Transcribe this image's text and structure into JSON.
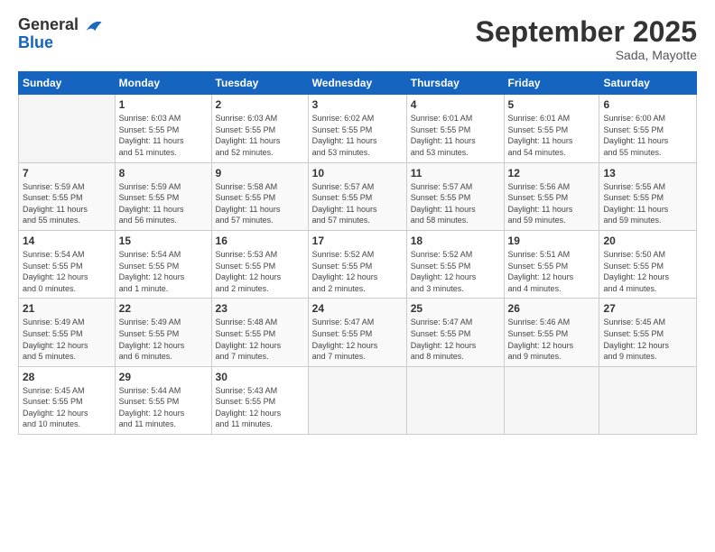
{
  "header": {
    "logo_general": "General",
    "logo_blue": "Blue",
    "month_title": "September 2025",
    "location": "Sada, Mayotte"
  },
  "columns": [
    "Sunday",
    "Monday",
    "Tuesday",
    "Wednesday",
    "Thursday",
    "Friday",
    "Saturday"
  ],
  "weeks": [
    [
      {
        "day": "",
        "info": ""
      },
      {
        "day": "1",
        "info": "Sunrise: 6:03 AM\nSunset: 5:55 PM\nDaylight: 11 hours\nand 51 minutes."
      },
      {
        "day": "2",
        "info": "Sunrise: 6:03 AM\nSunset: 5:55 PM\nDaylight: 11 hours\nand 52 minutes."
      },
      {
        "day": "3",
        "info": "Sunrise: 6:02 AM\nSunset: 5:55 PM\nDaylight: 11 hours\nand 53 minutes."
      },
      {
        "day": "4",
        "info": "Sunrise: 6:01 AM\nSunset: 5:55 PM\nDaylight: 11 hours\nand 53 minutes."
      },
      {
        "day": "5",
        "info": "Sunrise: 6:01 AM\nSunset: 5:55 PM\nDaylight: 11 hours\nand 54 minutes."
      },
      {
        "day": "6",
        "info": "Sunrise: 6:00 AM\nSunset: 5:55 PM\nDaylight: 11 hours\nand 55 minutes."
      }
    ],
    [
      {
        "day": "7",
        "info": "Sunrise: 5:59 AM\nSunset: 5:55 PM\nDaylight: 11 hours\nand 55 minutes."
      },
      {
        "day": "8",
        "info": "Sunrise: 5:59 AM\nSunset: 5:55 PM\nDaylight: 11 hours\nand 56 minutes."
      },
      {
        "day": "9",
        "info": "Sunrise: 5:58 AM\nSunset: 5:55 PM\nDaylight: 11 hours\nand 57 minutes."
      },
      {
        "day": "10",
        "info": "Sunrise: 5:57 AM\nSunset: 5:55 PM\nDaylight: 11 hours\nand 57 minutes."
      },
      {
        "day": "11",
        "info": "Sunrise: 5:57 AM\nSunset: 5:55 PM\nDaylight: 11 hours\nand 58 minutes."
      },
      {
        "day": "12",
        "info": "Sunrise: 5:56 AM\nSunset: 5:55 PM\nDaylight: 11 hours\nand 59 minutes."
      },
      {
        "day": "13",
        "info": "Sunrise: 5:55 AM\nSunset: 5:55 PM\nDaylight: 11 hours\nand 59 minutes."
      }
    ],
    [
      {
        "day": "14",
        "info": "Sunrise: 5:54 AM\nSunset: 5:55 PM\nDaylight: 12 hours\nand 0 minutes."
      },
      {
        "day": "15",
        "info": "Sunrise: 5:54 AM\nSunset: 5:55 PM\nDaylight: 12 hours\nand 1 minute."
      },
      {
        "day": "16",
        "info": "Sunrise: 5:53 AM\nSunset: 5:55 PM\nDaylight: 12 hours\nand 2 minutes."
      },
      {
        "day": "17",
        "info": "Sunrise: 5:52 AM\nSunset: 5:55 PM\nDaylight: 12 hours\nand 2 minutes."
      },
      {
        "day": "18",
        "info": "Sunrise: 5:52 AM\nSunset: 5:55 PM\nDaylight: 12 hours\nand 3 minutes."
      },
      {
        "day": "19",
        "info": "Sunrise: 5:51 AM\nSunset: 5:55 PM\nDaylight: 12 hours\nand 4 minutes."
      },
      {
        "day": "20",
        "info": "Sunrise: 5:50 AM\nSunset: 5:55 PM\nDaylight: 12 hours\nand 4 minutes."
      }
    ],
    [
      {
        "day": "21",
        "info": "Sunrise: 5:49 AM\nSunset: 5:55 PM\nDaylight: 12 hours\nand 5 minutes."
      },
      {
        "day": "22",
        "info": "Sunrise: 5:49 AM\nSunset: 5:55 PM\nDaylight: 12 hours\nand 6 minutes."
      },
      {
        "day": "23",
        "info": "Sunrise: 5:48 AM\nSunset: 5:55 PM\nDaylight: 12 hours\nand 7 minutes."
      },
      {
        "day": "24",
        "info": "Sunrise: 5:47 AM\nSunset: 5:55 PM\nDaylight: 12 hours\nand 7 minutes."
      },
      {
        "day": "25",
        "info": "Sunrise: 5:47 AM\nSunset: 5:55 PM\nDaylight: 12 hours\nand 8 minutes."
      },
      {
        "day": "26",
        "info": "Sunrise: 5:46 AM\nSunset: 5:55 PM\nDaylight: 12 hours\nand 9 minutes."
      },
      {
        "day": "27",
        "info": "Sunrise: 5:45 AM\nSunset: 5:55 PM\nDaylight: 12 hours\nand 9 minutes."
      }
    ],
    [
      {
        "day": "28",
        "info": "Sunrise: 5:45 AM\nSunset: 5:55 PM\nDaylight: 12 hours\nand 10 minutes."
      },
      {
        "day": "29",
        "info": "Sunrise: 5:44 AM\nSunset: 5:55 PM\nDaylight: 12 hours\nand 11 minutes."
      },
      {
        "day": "30",
        "info": "Sunrise: 5:43 AM\nSunset: 5:55 PM\nDaylight: 12 hours\nand 11 minutes."
      },
      {
        "day": "",
        "info": ""
      },
      {
        "day": "",
        "info": ""
      },
      {
        "day": "",
        "info": ""
      },
      {
        "day": "",
        "info": ""
      }
    ]
  ]
}
